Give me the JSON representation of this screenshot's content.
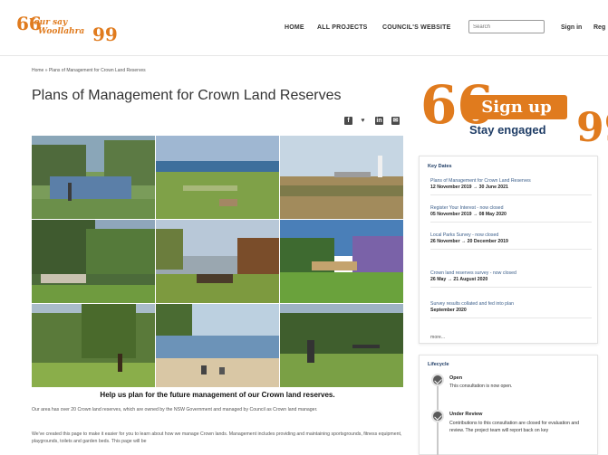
{
  "header": {
    "logo_line1": "Your say",
    "logo_line2": "Woollahra",
    "logo_quote_open": "66",
    "logo_quote_close": "99",
    "nav": [
      "HOME",
      "ALL PROJECTS",
      "COUNCIL'S WEBSITE"
    ],
    "search_placeholder": "Search",
    "sign_in": "Sign in",
    "register": "Reg"
  },
  "breadcrumb": "Home » Plans of Management for Crown Land Reserves",
  "page_title": "Plans of Management for Crown Land Reserves",
  "share": {
    "icons": [
      "facebook-icon",
      "twitter-icon",
      "linkedin-icon",
      "email-icon"
    ],
    "facebook_glyph": "f",
    "twitter_glyph": "♥",
    "linkedin_glyph": "in",
    "email_glyph": "✉"
  },
  "callout": "Help us plan for the future management of our Crown land reserves.",
  "intro": {
    "p1": "Our area has over 20 Crown land reserves, which are owned by the NSW Government and managed by Council as Crown land manager.",
    "p2": "We've created this page to make it easier for you to learn about how we manage Crown lands. Management includes providing and maintaining sportsgrounds, fitness equipment, playgrounds, toilets and garden beds. This page will be"
  },
  "signup": {
    "quote_open": "66",
    "quote_close": "99",
    "label": "Sign up",
    "tagline": "Stay engaged"
  },
  "key_dates": {
    "heading": "Key Dates",
    "items": [
      {
        "label": "Plans of Management for Crown Land Reserves",
        "date": "12 November 2019 → 30 June 2021"
      },
      {
        "label": "Register Your Interest - now closed",
        "date": "05 November 2019 → 08 May 2020"
      },
      {
        "label": "Local Parks Survey - now closed",
        "date": "26 November → 20 December 2019"
      },
      {
        "label": "Crown land reserves survey - now closed",
        "date": "26 May → 21 August 2020"
      },
      {
        "label": "Survey results collated and fed into plan",
        "date": "September 2020"
      }
    ],
    "more": "more..."
  },
  "lifecycle": {
    "heading": "Lifecycle",
    "stages": [
      {
        "title": "Open",
        "text": "This consultation is now open."
      },
      {
        "title": "Under Review",
        "text": "Contributions to this consultation are closed for evaluation and review. The project team will report back on key"
      }
    ]
  },
  "colors": {
    "brand_orange": "#e07b1e",
    "navy": "#1f3d66",
    "link_blue": "#3b5e8a"
  }
}
